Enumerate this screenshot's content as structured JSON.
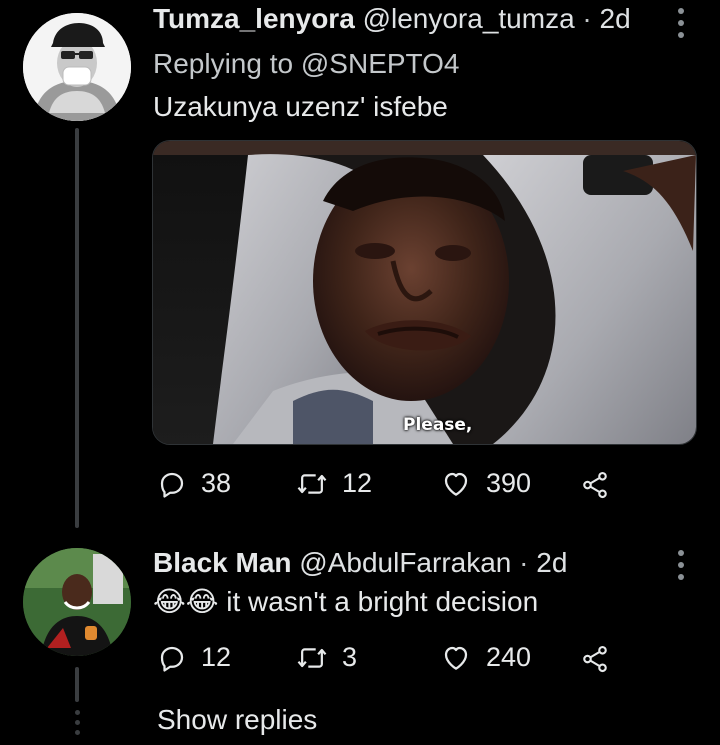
{
  "tweets": [
    {
      "name": "Tumza_lenyora",
      "handle": "@lenyora_tumza",
      "separator": "·",
      "time": "2d",
      "replying_prefix": "Replying to",
      "replying_to": "@SNEPTO4",
      "text": "Uzakunya uzenz' isfebe",
      "media_caption": "Please,",
      "actions": {
        "replies": "38",
        "retweets": "12",
        "likes": "390"
      }
    },
    {
      "name": "Black Man",
      "handle": "@AbdulFarrakan",
      "separator": "·",
      "time": "2d",
      "emoji": "😂😂",
      "text": "it wasn't a bright decision",
      "actions": {
        "replies": "12",
        "retweets": "3",
        "likes": "240"
      }
    }
  ],
  "show_replies_label": "Show replies",
  "icons": {
    "reply": "reply-icon",
    "retweet": "retweet-icon",
    "like": "heart-icon",
    "share": "share-icon",
    "more": "more-options-icon"
  },
  "colors": {
    "background": "#000000",
    "text": "#e7e9ea",
    "secondary": "#c4c8cb",
    "thread_line": "#3a3d40"
  }
}
